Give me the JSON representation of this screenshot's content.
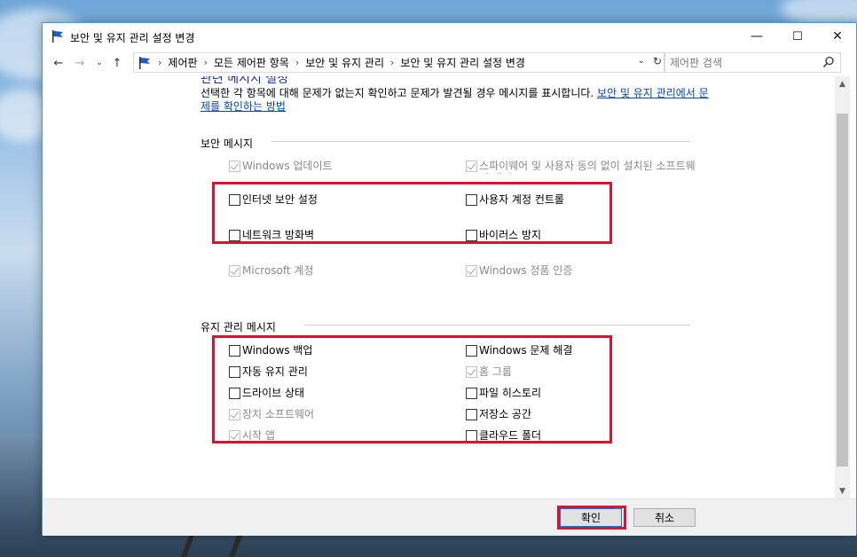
{
  "window": {
    "title": "보안 및 유지 관리 설정 변경",
    "controls": {
      "minimize": "—",
      "maximize": "☐",
      "close": "✕"
    }
  },
  "address": {
    "breadcrumbs": [
      "제어판",
      "모든 제어판 항목",
      "보안 및 유지 관리",
      "보안 및 유지 관리 설정 변경"
    ],
    "search_placeholder": "제어판 검색"
  },
  "content": {
    "cut_heading": "관련 메시지 설정",
    "description": "선택한 각 항목에 대해 문제가 없는지 확인하고 문제가 발견될 경우 메시지를 표시합니다.",
    "link_text": "보안 및 유지 관리에서 문제를 확인하는 방법",
    "security": {
      "title": "보안 메시지",
      "items": [
        {
          "label": "Windows 업데이트",
          "checked": true,
          "disabled": true
        },
        {
          "label": "스파이웨어 및 사용자 동의 없이 설치된 소프트웨어 방지",
          "checked": true,
          "disabled": true
        },
        {
          "label": "인터넷 보안 설정",
          "checked": false,
          "disabled": false
        },
        {
          "label": "사용자 계정 컨트롤",
          "checked": false,
          "disabled": false
        },
        {
          "label": "네트워크 방화벽",
          "checked": false,
          "disabled": false
        },
        {
          "label": "바이러스 방지",
          "checked": false,
          "disabled": false
        },
        {
          "label": "Microsoft 계정",
          "checked": true,
          "disabled": true
        },
        {
          "label": "Windows 정품 인증",
          "checked": true,
          "disabled": true
        }
      ]
    },
    "maintenance": {
      "title": "유지 관리 메시지",
      "items": [
        {
          "label": "Windows 백업",
          "checked": false,
          "disabled": false
        },
        {
          "label": "Windows 문제 해결",
          "checked": false,
          "disabled": false
        },
        {
          "label": "자동 유지 관리",
          "checked": false,
          "disabled": false
        },
        {
          "label": "홈 그룹",
          "checked": true,
          "disabled": true
        },
        {
          "label": "드라이브 상태",
          "checked": false,
          "disabled": false
        },
        {
          "label": "파일 히스토리",
          "checked": false,
          "disabled": false
        },
        {
          "label": "장치 소프트웨어",
          "checked": true,
          "disabled": true
        },
        {
          "label": "저장소 공간",
          "checked": false,
          "disabled": false
        },
        {
          "label": "시작 앱",
          "checked": true,
          "disabled": true
        },
        {
          "label": "클라우드 폴더",
          "checked": false,
          "disabled": false
        }
      ]
    }
  },
  "footer": {
    "ok_label": "확인",
    "cancel_label": "취소"
  },
  "colors": {
    "highlight": "#e0102b",
    "link": "#0645ad",
    "accent": "#0078d7"
  }
}
